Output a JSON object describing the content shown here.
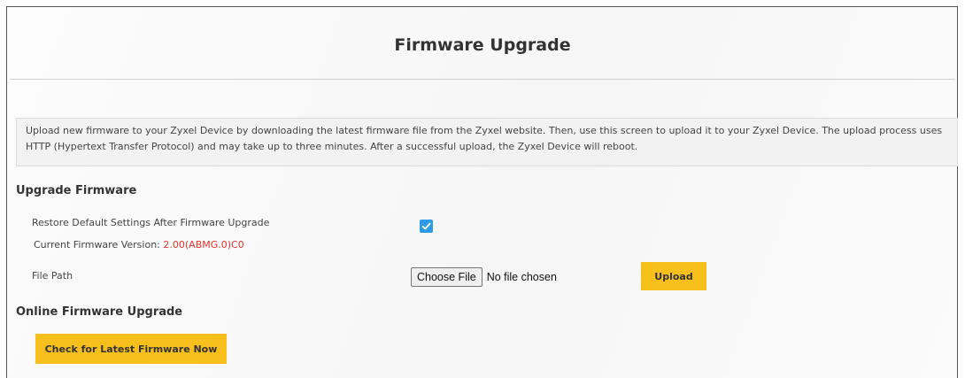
{
  "page": {
    "title": "Firmware Upgrade",
    "description": "Upload new firmware to your Zyxel Device by downloading the latest firmware file from the Zyxel website. Then, use this screen to upload it to your Zyxel Device. The upload process uses HTTP (Hypertext Transfer Protocol) and may take up to three minutes. After a successful upload, the Zyxel Device will reboot."
  },
  "upgrade_firmware": {
    "section_title": "Upgrade Firmware",
    "restore_label": "Restore Default Settings After Firmware Upgrade",
    "restore_checked": true,
    "current_version_label": "Current Firmware Version:",
    "current_version_value": "2.00(ABMG.0)C0",
    "file_path_label": "File Path",
    "choose_file_label": "Choose File",
    "file_status": "No file chosen",
    "upload_label": "Upload"
  },
  "online_upgrade": {
    "section_title": "Online Firmware Upgrade",
    "check_label": "Check for Latest Firmware Now"
  },
  "colors": {
    "accent_yellow": "#f6bf1c",
    "checkbox_blue": "#2e9be6",
    "version_red": "#e8332a"
  }
}
